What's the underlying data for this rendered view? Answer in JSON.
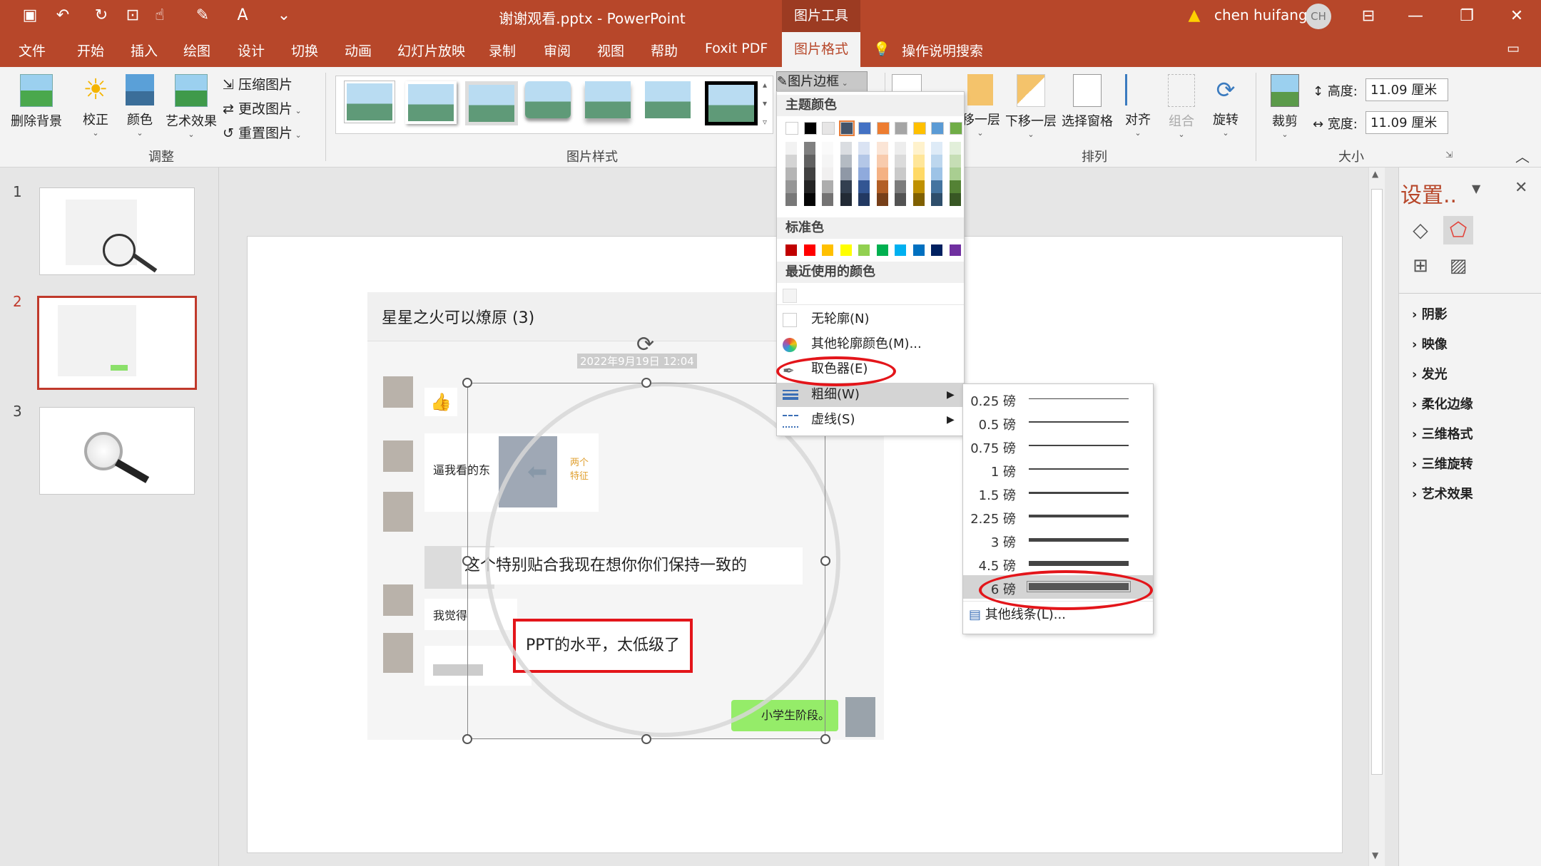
{
  "app": {
    "doc_title": "谢谢观看.pptx  -  PowerPoint",
    "tools_label": "图片工具",
    "user_name": "chen huifang",
    "avatar_initials": "CH"
  },
  "tabs": [
    "文件",
    "开始",
    "插入",
    "绘图",
    "设计",
    "切换",
    "动画",
    "幻灯片放映",
    "录制",
    "审阅",
    "视图",
    "帮助",
    "Foxit PDF"
  ],
  "active_tab": "图片格式",
  "tell_me": "操作说明搜索",
  "ribbon": {
    "remove_bg": "删除背景",
    "correct": "校正",
    "color": "颜色",
    "artistic": "艺术效果",
    "compress": "压缩图片",
    "change": "更改图片",
    "reset": "重置图片",
    "group_adjust": "调整",
    "group_styles": "图片样式",
    "border_btn": "图片边框",
    "send_back": "移一层",
    "bring_forward": "下移一层",
    "selection_pane": "选择窗格",
    "align": "对齐",
    "group_btn": "组合",
    "rotate": "旋转",
    "group_arrange": "排列",
    "crop": "裁剪",
    "height_label": "高度:",
    "height_value": "11.09 厘米",
    "width_label": "宽度:",
    "width_value": "11.09 厘米",
    "group_size": "大小"
  },
  "slides": [
    "1",
    "2",
    "3"
  ],
  "slide_content": {
    "chat_title": "星星之火可以燎原 (3)",
    "timestamp": "2022年9月19日 12:04",
    "msg_partial": "逼我看的东",
    "msg_side": "两个特征",
    "msg_main": "这个特别贴合我现在想你你们保持一致的",
    "msg_short": "我觉得",
    "msg_highlight": "PPT的水平，太低级了",
    "msg_green": "小学生阶段。"
  },
  "dropdown": {
    "theme_colors": "主题颜色",
    "standard_colors": "标准色",
    "recent_colors": "最近使用的颜色",
    "no_outline": "无轮廓(N)",
    "more_colors": "其他轮廓颜色(M)...",
    "eyedropper": "取色器(E)",
    "weight": "粗细(W)",
    "dashes": "虚线(S)",
    "theme_top": [
      "#ffffff",
      "#000000",
      "#e7e6e6",
      "#44546a",
      "#4472c4",
      "#ed7d31",
      "#a5a5a5",
      "#ffc000",
      "#5b9bd5",
      "#70ad47"
    ],
    "standard": [
      "#c00000",
      "#ff0000",
      "#ffc000",
      "#ffff00",
      "#92d050",
      "#00b050",
      "#00b0f0",
      "#0070c0",
      "#002060",
      "#7030a0"
    ]
  },
  "weights": {
    "items": [
      "0.25 磅",
      "0.5 磅",
      "0.75 磅",
      "1 磅",
      "1.5 磅",
      "2.25 磅",
      "3 磅",
      "4.5 磅",
      "6 磅"
    ],
    "more_lines": "其他线条(L)..."
  },
  "right_pane": {
    "title": "设置..",
    "items": [
      "阴影",
      "映像",
      "发光",
      "柔化边缘",
      "三维格式",
      "三维旋转",
      "艺术效果"
    ]
  }
}
